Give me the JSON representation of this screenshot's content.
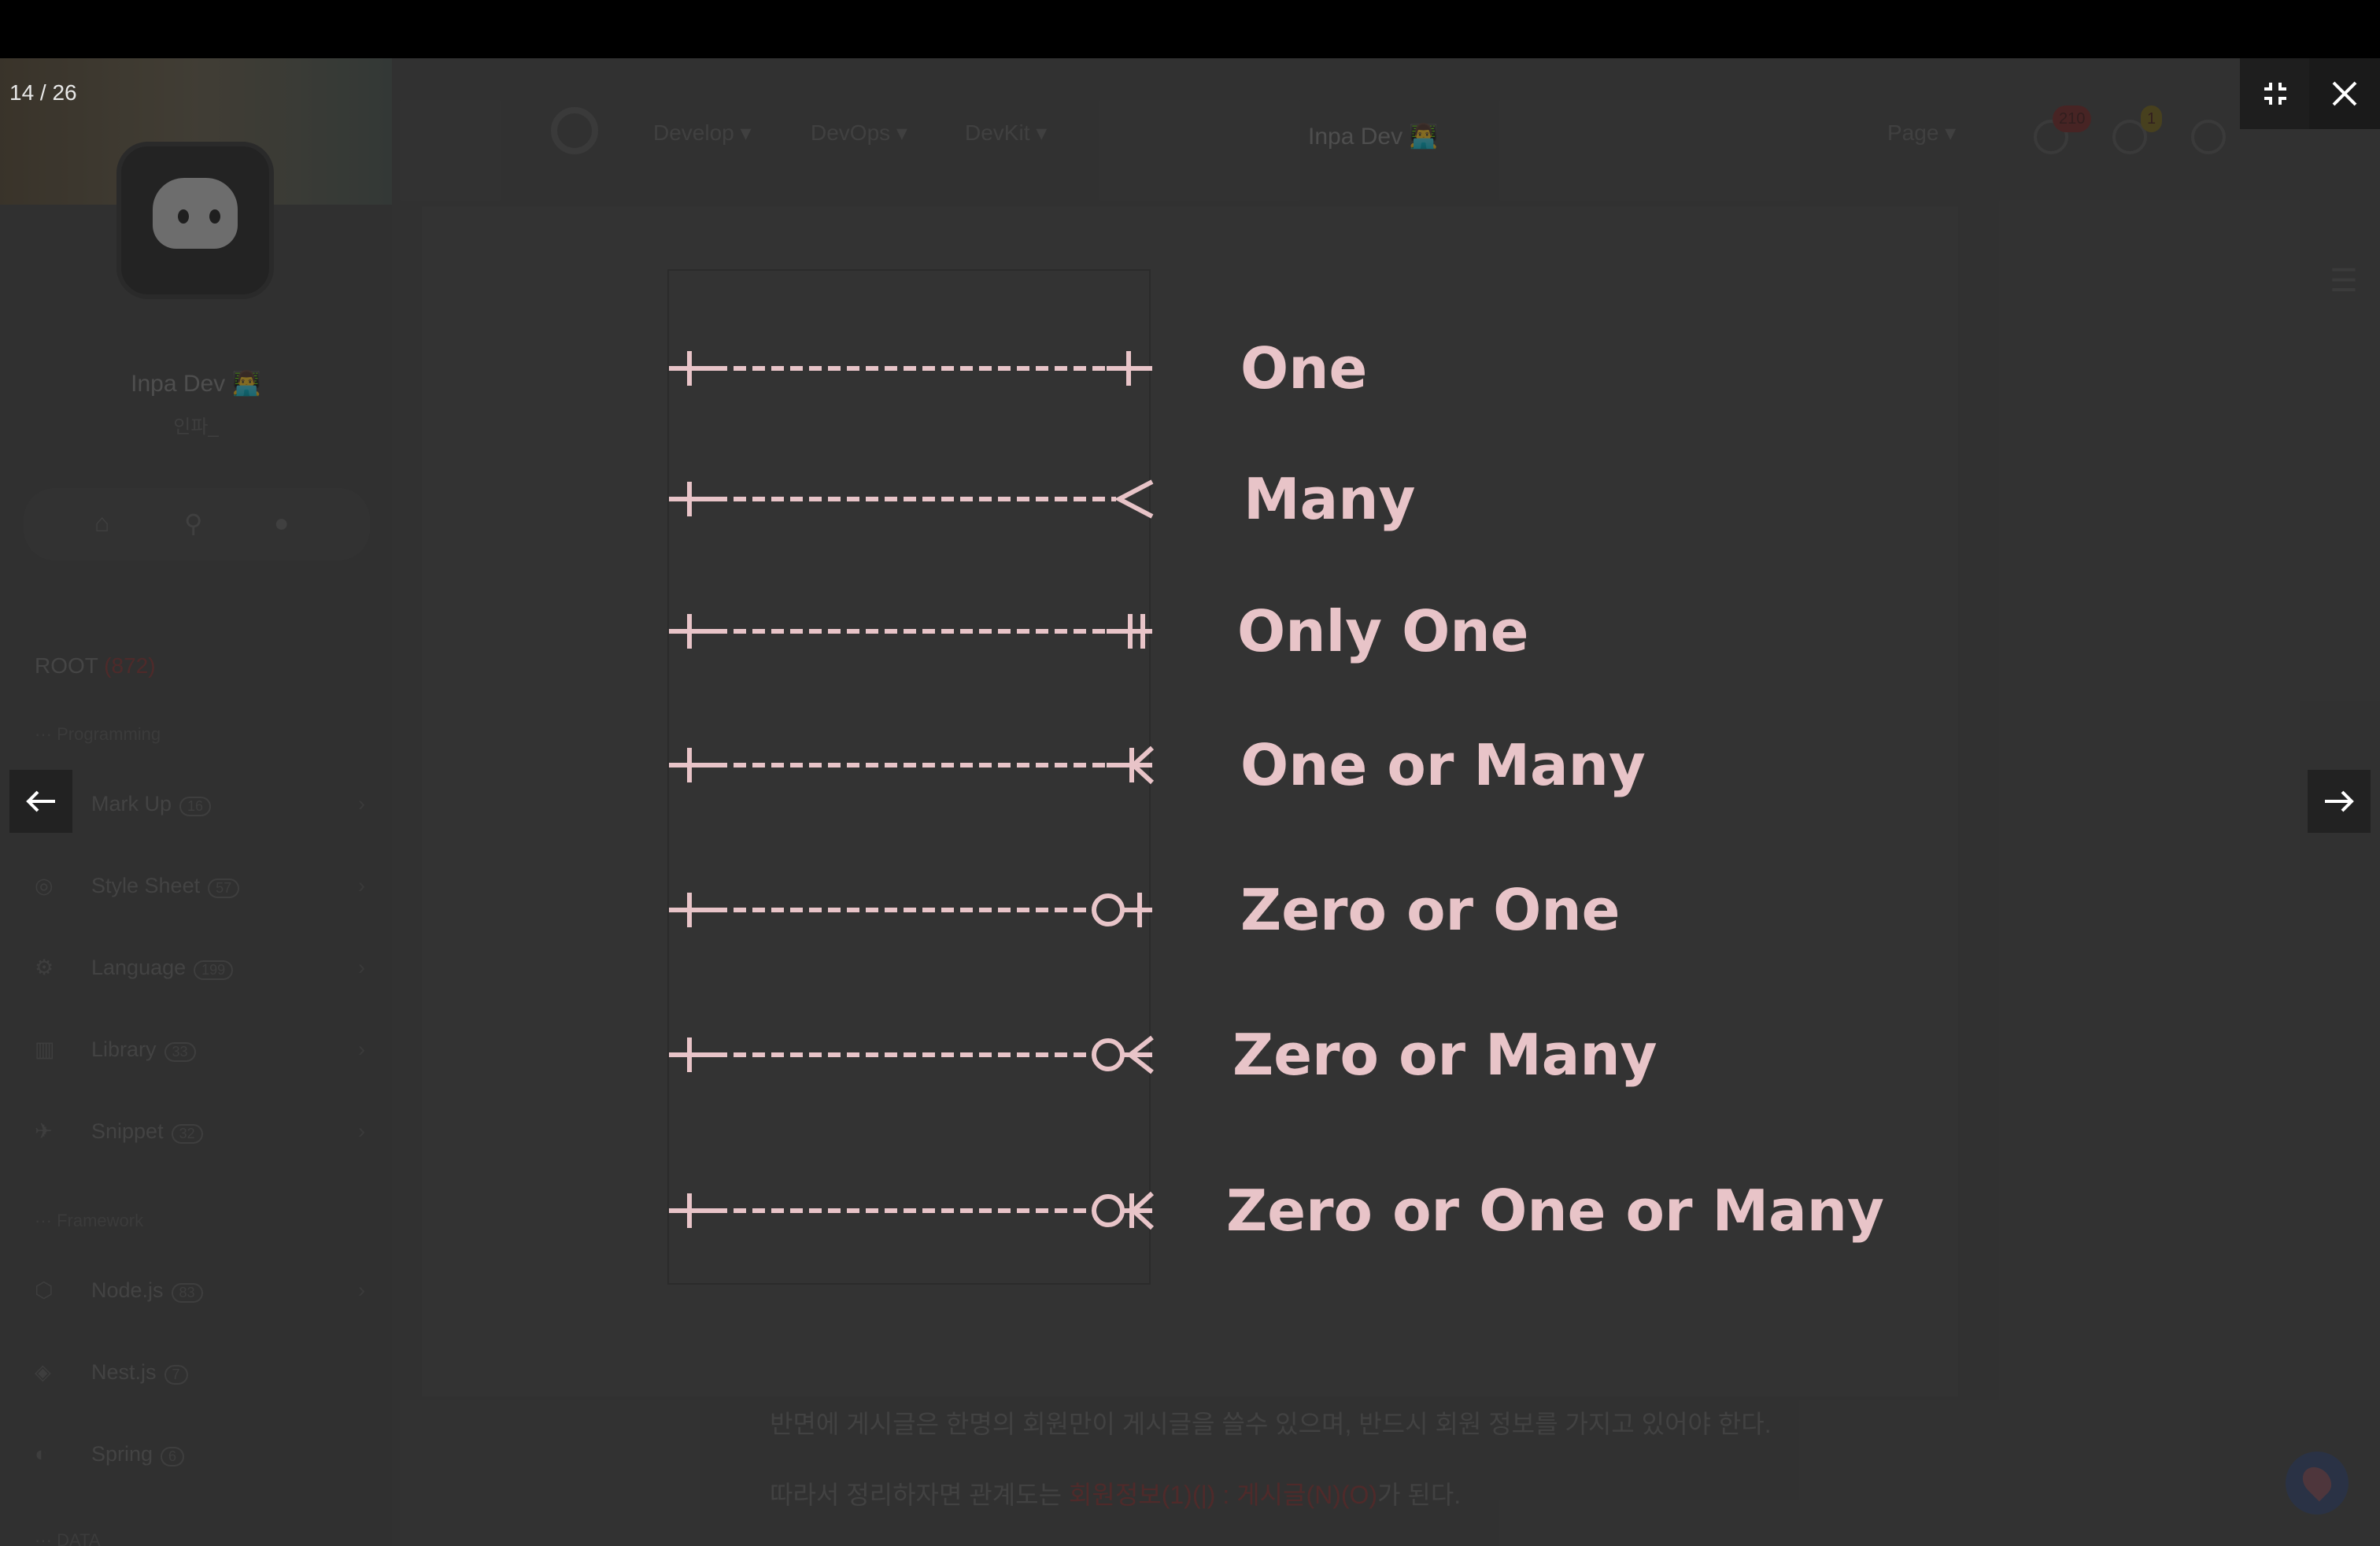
{
  "viewer": {
    "counter": "14 / 26",
    "icons": {
      "minimize": "fullscreen-exit-icon",
      "close": "close-icon",
      "prev": "arrow-left-icon",
      "next": "arrow-right-icon"
    }
  },
  "background_page": {
    "nav": {
      "menus": [
        "Develop",
        "DevOps",
        "DevKit"
      ],
      "brand": "Inpa Dev 👨‍💻",
      "page_menu": "Page",
      "badge_notifications": "210",
      "badge_comments": "1"
    },
    "profile": {
      "name": "Inpa Dev 👨‍💻",
      "handle": "인파_"
    },
    "root_label": "ROOT",
    "root_count": "(872)",
    "sections": [
      "Programming",
      "Framework",
      "DATA"
    ],
    "categories": [
      {
        "label": "Mark Up",
        "count": "16"
      },
      {
        "label": "Style Sheet",
        "count": "57"
      },
      {
        "label": "Language",
        "count": "199"
      },
      {
        "label": "Library",
        "count": "33"
      },
      {
        "label": "Snippet",
        "count": "32"
      },
      {
        "label": "Node.js",
        "count": "83"
      },
      {
        "label": "Nest.js",
        "count": "7"
      },
      {
        "label": "Spring",
        "count": "6"
      }
    ],
    "paragraph1": "반면에 게시글은 한명의 회원만이 게시글을 쓸수 있으며, 반드시 회원 정보를 가지고 있어야 한다.",
    "paragraph2_prefix": "따라서 정리하자면 관계도는 ",
    "paragraph2_highlight": "회원정보(1)(|) : 게시글(N)(O)",
    "paragraph2_suffix": "가 된다."
  },
  "image": {
    "labels": [
      "One",
      "Many",
      "Only One",
      "One or Many",
      "Zero or One",
      "Zero or Many",
      "Zero or One or Many"
    ],
    "line_color": "#e8c4c8",
    "panel_color": "#333333"
  }
}
